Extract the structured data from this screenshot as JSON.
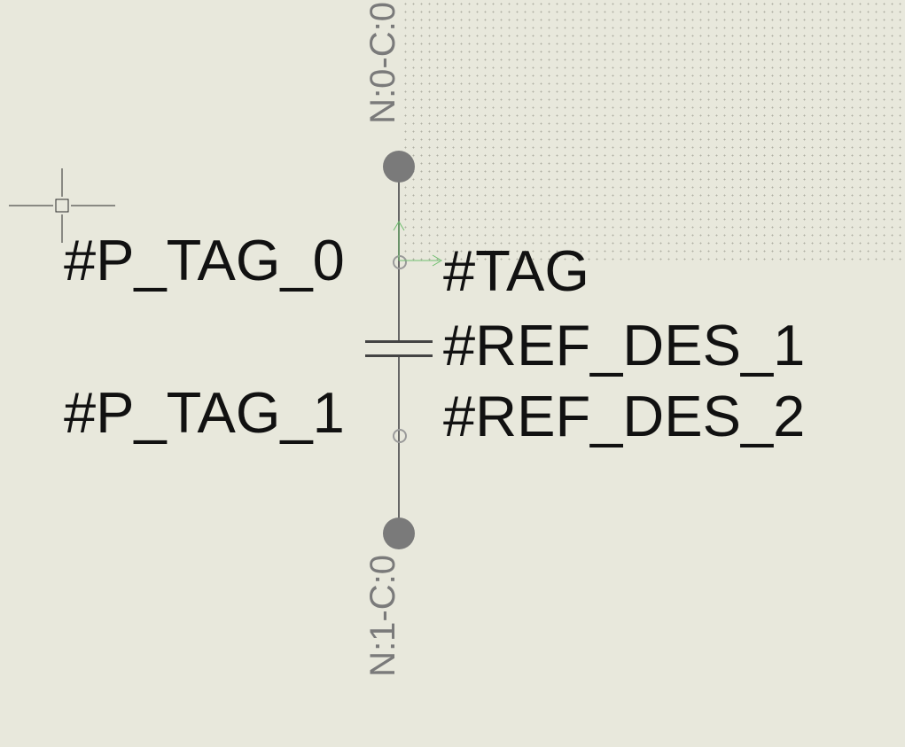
{
  "labels": {
    "p_tag_0": "#P_TAG_0",
    "p_tag_1": "#P_TAG_1",
    "tag": "#TAG",
    "ref_des_1": "#REF_DES_1",
    "ref_des_2": "#REF_DES_2"
  },
  "nets": {
    "top": "N:0-C:0",
    "bottom": "N:1-C:0"
  },
  "colors": {
    "bg": "#e8e8dc",
    "wire": "#666666",
    "node": "#7a7a7a",
    "text": "#111111",
    "net_text": "#7a7a7a"
  },
  "component": {
    "type": "capacitor",
    "pins": [
      "0",
      "1"
    ]
  }
}
